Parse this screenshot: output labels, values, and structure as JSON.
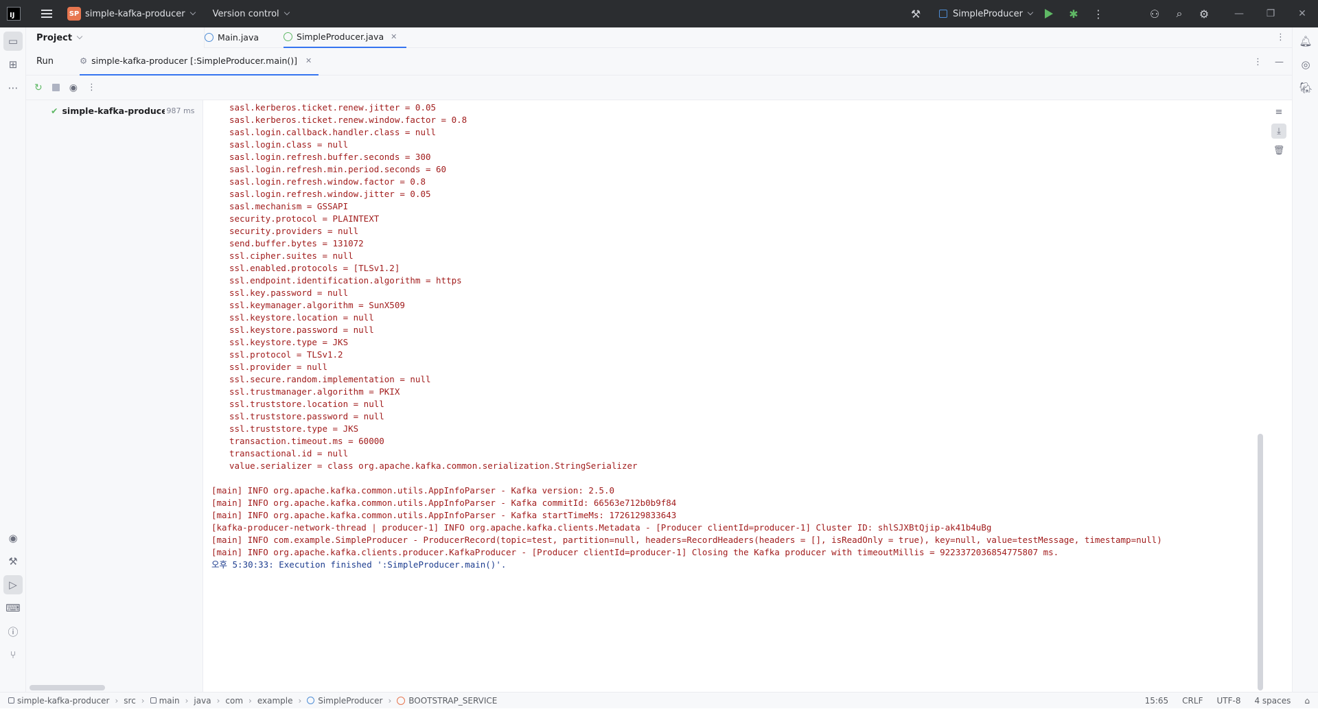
{
  "titlebar": {
    "app_logo": "IJ",
    "project_badge": "SP",
    "project_name": "simple-kafka-producer",
    "vcs_label": "Version control",
    "run_config": "SimpleProducer"
  },
  "panels": {
    "project_label": "Project"
  },
  "editor_tabs": [
    {
      "label": "Main.java"
    },
    {
      "label": "SimpleProducer.java"
    }
  ],
  "run": {
    "label": "Run",
    "tab_label": "simple-kafka-producer [:SimpleProducer.main()]",
    "tree_item": "simple-kafka-producer [:SimpleProducer.main()]",
    "tree_time": "987 ms"
  },
  "console": {
    "lines": [
      {
        "text": "\tsasl.kerberos.ticket.renew.jitter = 0.05",
        "color": "#a11c1c"
      },
      {
        "text": "\tsasl.kerberos.ticket.renew.window.factor = 0.8",
        "color": "#a11c1c"
      },
      {
        "text": "\tsasl.login.callback.handler.class = null",
        "color": "#a11c1c"
      },
      {
        "text": "\tsasl.login.class = null",
        "color": "#a11c1c"
      },
      {
        "text": "\tsasl.login.refresh.buffer.seconds = 300",
        "color": "#a11c1c"
      },
      {
        "text": "\tsasl.login.refresh.min.period.seconds = 60",
        "color": "#a11c1c"
      },
      {
        "text": "\tsasl.login.refresh.window.factor = 0.8",
        "color": "#a11c1c"
      },
      {
        "text": "\tsasl.login.refresh.window.jitter = 0.05",
        "color": "#a11c1c"
      },
      {
        "text": "\tsasl.mechanism = GSSAPI",
        "color": "#a11c1c"
      },
      {
        "text": "\tsecurity.protocol = PLAINTEXT",
        "color": "#a11c1c"
      },
      {
        "text": "\tsecurity.providers = null",
        "color": "#a11c1c"
      },
      {
        "text": "\tsend.buffer.bytes = 131072",
        "color": "#a11c1c"
      },
      {
        "text": "\tssl.cipher.suites = null",
        "color": "#a11c1c"
      },
      {
        "text": "\tssl.enabled.protocols = [TLSv1.2]",
        "color": "#a11c1c"
      },
      {
        "text": "\tssl.endpoint.identification.algorithm = https",
        "color": "#a11c1c"
      },
      {
        "text": "\tssl.key.password = null",
        "color": "#a11c1c"
      },
      {
        "text": "\tssl.keymanager.algorithm = SunX509",
        "color": "#a11c1c"
      },
      {
        "text": "\tssl.keystore.location = null",
        "color": "#a11c1c"
      },
      {
        "text": "\tssl.keystore.password = null",
        "color": "#a11c1c"
      },
      {
        "text": "\tssl.keystore.type = JKS",
        "color": "#a11c1c"
      },
      {
        "text": "\tssl.protocol = TLSv1.2",
        "color": "#a11c1c"
      },
      {
        "text": "\tssl.provider = null",
        "color": "#a11c1c"
      },
      {
        "text": "\tssl.secure.random.implementation = null",
        "color": "#a11c1c"
      },
      {
        "text": "\tssl.trustmanager.algorithm = PKIX",
        "color": "#a11c1c"
      },
      {
        "text": "\tssl.truststore.location = null",
        "color": "#a11c1c"
      },
      {
        "text": "\tssl.truststore.password = null",
        "color": "#a11c1c"
      },
      {
        "text": "\tssl.truststore.type = JKS",
        "color": "#a11c1c"
      },
      {
        "text": "\ttransaction.timeout.ms = 60000",
        "color": "#a11c1c"
      },
      {
        "text": "\ttransactional.id = null",
        "color": "#a11c1c"
      },
      {
        "text": "\tvalue.serializer = class org.apache.kafka.common.serialization.StringSerializer",
        "color": "#a11c1c"
      },
      {
        "text": "",
        "color": "#a11c1c"
      },
      {
        "text": "[main] INFO org.apache.kafka.common.utils.AppInfoParser - Kafka version: 2.5.0",
        "color": "#a11c1c"
      },
      {
        "text": "[main] INFO org.apache.kafka.common.utils.AppInfoParser - Kafka commitId: 66563e712b0b9f84",
        "color": "#a11c1c"
      },
      {
        "text": "[main] INFO org.apache.kafka.common.utils.AppInfoParser - Kafka startTimeMs: 1726129833643",
        "color": "#a11c1c"
      },
      {
        "text": "[kafka-producer-network-thread | producer-1] INFO org.apache.kafka.clients.Metadata - [Producer clientId=producer-1] Cluster ID: shlSJXBtQjip-ak41b4uBg",
        "color": "#a11c1c"
      },
      {
        "text": "[main] INFO com.example.SimpleProducer - ProducerRecord(topic=test, partition=null, headers=RecordHeaders(headers = [], isReadOnly = true), key=null, value=testMessage, timestamp=null)",
        "color": "#a11c1c"
      },
      {
        "text": "[main] INFO org.apache.kafka.clients.producer.KafkaProducer - [Producer clientId=producer-1] Closing the Kafka producer with timeoutMillis = 9223372036854775807 ms.",
        "color": "#a11c1c"
      },
      {
        "text": "오후 5:30:33: Execution finished ':SimpleProducer.main()'.",
        "color": "#1d3d8f"
      }
    ]
  },
  "statusbar": {
    "breadcrumbs": [
      "simple-kafka-producer",
      "src",
      "main",
      "java",
      "com",
      "example",
      "SimpleProducer",
      "BOOTSTRAP_SERVICE"
    ],
    "position": "15:65",
    "line_sep": "CRLF",
    "encoding": "UTF-8",
    "indent": "4 spaces"
  }
}
